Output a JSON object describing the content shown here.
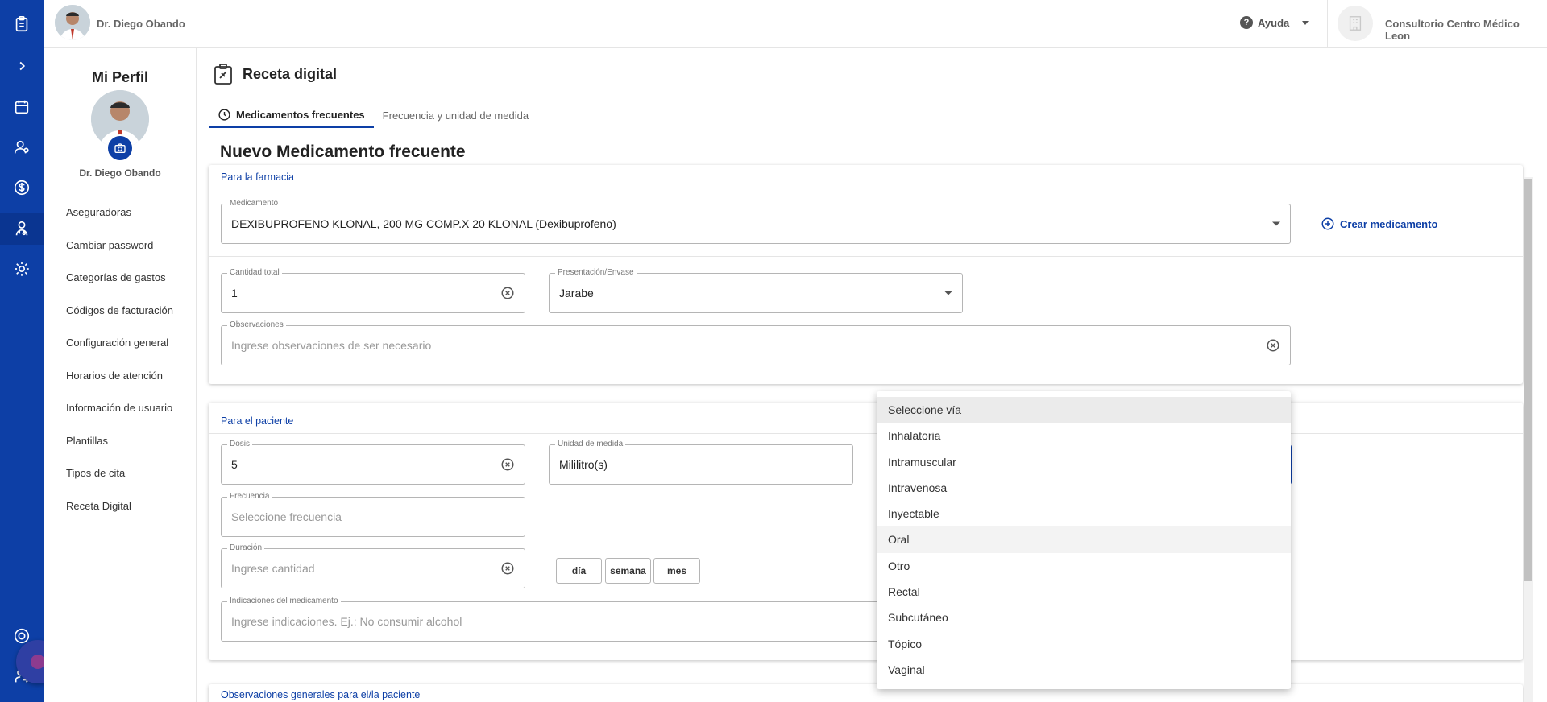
{
  "topbar": {
    "doctor_name": "Dr. Diego Obando",
    "help_label": "Ayuda",
    "clinic_name": "Consultorio Centro Médico Leon"
  },
  "rail": {
    "icons": [
      "clipboard-icon",
      "chevron-right-icon",
      "calendar-icon",
      "patients-icon",
      "dollar-icon",
      "doctor-icon",
      "settings-icon",
      "support-icon",
      "logout-icon"
    ]
  },
  "profile": {
    "heading": "Mi Perfil",
    "name": "Dr. Diego Obando",
    "menu": [
      "Aseguradoras",
      "Cambiar password",
      "Categorías de gastos",
      "Códigos de facturación",
      "Configuración general",
      "Horarios de atención",
      "Información de usuario",
      "Plantillas",
      "Tipos de cita",
      "Receta Digital"
    ]
  },
  "page": {
    "title": "Receta digital",
    "tabs": [
      "Medicamentos frecuentes",
      "Frecuencia y unidad de medida"
    ],
    "section_title": "Nuevo Medicamento frecuente"
  },
  "pharmacy": {
    "title": "Para la farmacia",
    "medicamento_label": "Medicamento",
    "medicamento_value": "DEXIBUPROFENO KLONAL, 200 MG COMP.X 20 KLONAL (Dexibuprofeno)",
    "create_label": "Crear medicamento",
    "cantidad_label": "Cantidad total",
    "cantidad_value": "1",
    "presentacion_label": "Presentación/Envase",
    "presentacion_value": "Jarabe",
    "observaciones_label": "Observaciones",
    "observaciones_placeholder": "Ingrese observaciones de ser necesario"
  },
  "patient": {
    "title": "Para el paciente",
    "dosis_label": "Dosis",
    "dosis_value": "5",
    "unidad_label": "Unidad de medida",
    "unidad_value": "Mililitro(s)",
    "frecuencia_label": "Frecuencia",
    "frecuencia_placeholder": "Seleccione frecuencia",
    "duracion_label": "Duración",
    "duracion_placeholder": "Ingrese cantidad",
    "unit_buttons": [
      "día",
      "semana",
      "mes"
    ],
    "indicaciones_label": "Indicaciones del medicamento",
    "indicaciones_placeholder": "Ingrese indicaciones. Ej.: No consumir alcohol"
  },
  "general": {
    "title": "Observaciones generales para el/la paciente"
  },
  "via_dropdown": {
    "options": [
      "Seleccione vía",
      "Inhalatoria",
      "Intramuscular",
      "Intravenosa",
      "Inyectable",
      "Oral",
      "Otro",
      "Rectal",
      "Subcutáneo",
      "Tópico",
      "Vaginal"
    ],
    "selected": "Seleccione vía",
    "hovered": "Oral"
  },
  "colors": {
    "primary": "#0d3fa6",
    "rail": "#0d3fa6"
  }
}
